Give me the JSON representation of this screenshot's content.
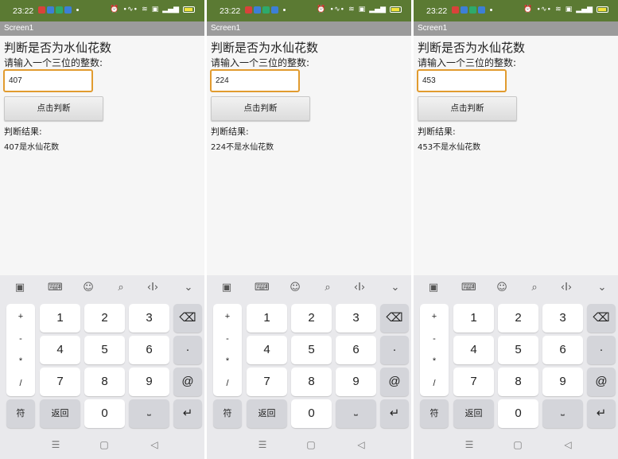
{
  "screens": [
    {
      "status": {
        "time": "23:22"
      },
      "titlebar": "Screen1",
      "heading": "判断是否为水仙花数",
      "prompt": "请输入一个三位的整数:",
      "input_value": "407",
      "button_label": "点击判断",
      "result_label": "判断结果:",
      "result_text": "407是水仙花数"
    },
    {
      "status": {
        "time": "23:22"
      },
      "titlebar": "Screen1",
      "heading": "判断是否为水仙花数",
      "prompt": "请输入一个三位的整数:",
      "input_value": "224",
      "button_label": "点击判断",
      "result_label": "判断结果:",
      "result_text": "224不是水仙花数"
    },
    {
      "status": {
        "time": "23:22"
      },
      "titlebar": "Screen1",
      "heading": "判断是否为水仙花数",
      "prompt": "请输入一个三位的整数:",
      "input_value": "453",
      "button_label": "点击判断",
      "result_label": "判断结果:",
      "result_text": "453不是水仙花数"
    }
  ],
  "keyboard": {
    "symbols": [
      "+",
      "-",
      "*",
      "/"
    ],
    "digits": [
      "1",
      "2",
      "3",
      "4",
      "5",
      "6",
      "7",
      "8",
      "9",
      "0"
    ],
    "dot": "·",
    "at": "@",
    "sym_key": "符",
    "back_key": "返回",
    "toolbar_icons": [
      "clipboard-icon",
      "keyboard-icon",
      "emoji-icon",
      "search-icon",
      "cursor-icon",
      "chevron-down-icon"
    ],
    "nav_icons": [
      "menu-icon",
      "home-icon",
      "back-icon"
    ]
  },
  "colors": {
    "statusbar": "#5b7a33",
    "titlebar": "#9b9b9b",
    "input_border": "#e19b2f",
    "keyboard_bg": "#e9e9ec"
  }
}
